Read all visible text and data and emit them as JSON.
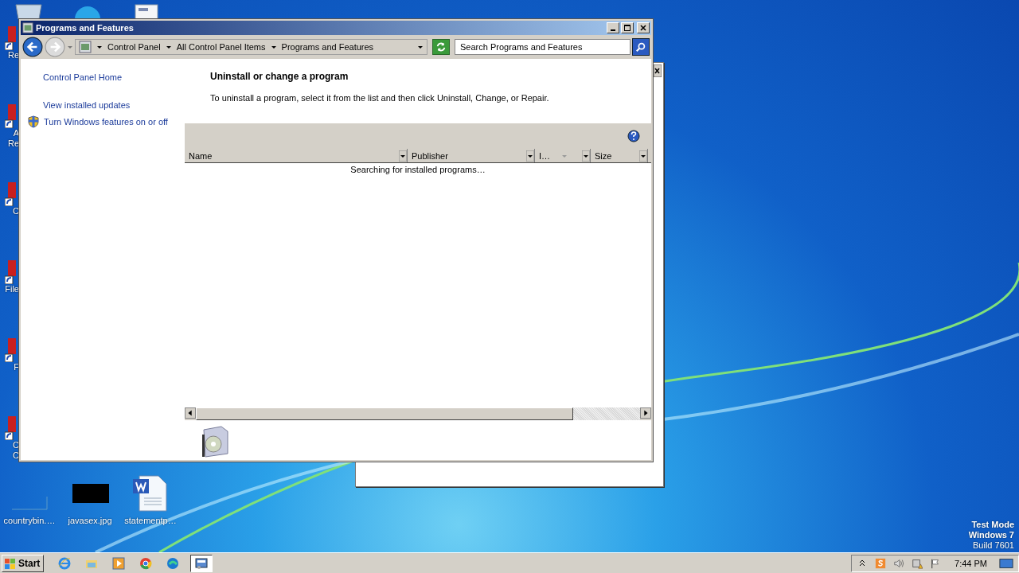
{
  "edge_icons": [
    {
      "lines": [
        "Re"
      ]
    },
    {
      "lines": [
        "A",
        "Re"
      ]
    },
    {
      "lines": [
        "C"
      ]
    },
    {
      "lines": [
        "File"
      ]
    },
    {
      "lines": [
        "F"
      ]
    },
    {
      "lines": [
        "C",
        "C"
      ]
    }
  ],
  "desktop_icons": [
    {
      "label": "countrybin.…",
      "kind": "blank"
    },
    {
      "label": "javasex.jpg",
      "kind": "image"
    },
    {
      "label": "statementp…",
      "kind": "word"
    }
  ],
  "window": {
    "title": "Programs and Features",
    "breadcrumb": [
      "Control Panel",
      "All Control Panel Items",
      "Programs and Features"
    ],
    "search": {
      "placeholder": "Search Programs and Features"
    },
    "sidebar": {
      "items": [
        {
          "label": "Control Panel Home",
          "kind": "link"
        },
        {
          "label": "View installed updates",
          "kind": "link"
        },
        {
          "label": "Turn Windows features on or off",
          "kind": "shield"
        }
      ]
    },
    "heading": "Uninstall or change a program",
    "description": "To uninstall a program, select it from the list and then click Uninstall, Change, or Repair.",
    "columns": [
      {
        "label": "Name",
        "kind": "plain"
      },
      {
        "label": "Publisher",
        "kind": "plain"
      },
      {
        "label": "I…",
        "kind": "sorted"
      },
      {
        "label": "Size",
        "kind": "plain"
      }
    ],
    "status": "Searching for installed programs…"
  },
  "system_notice": [
    "Test Mode",
    "Windows 7",
    "Build 7601"
  ],
  "taskbar": {
    "start": "Start",
    "apps": [
      {
        "kind": "ie",
        "selected": false
      },
      {
        "kind": "explorer",
        "selected": false
      },
      {
        "kind": "media",
        "selected": false
      },
      {
        "kind": "chrome",
        "selected": false
      },
      {
        "kind": "edge",
        "selected": false
      },
      {
        "kind": "control-panel",
        "selected": true
      }
    ],
    "clock": "7:44 PM"
  }
}
